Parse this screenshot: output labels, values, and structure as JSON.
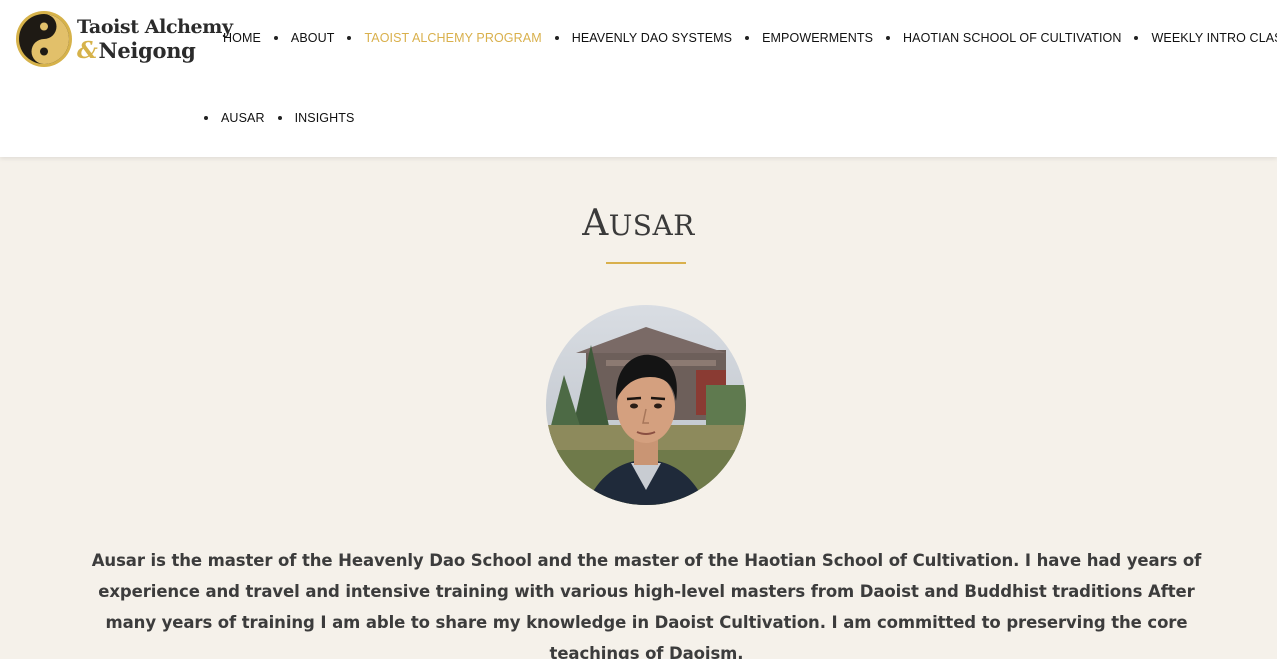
{
  "logo": {
    "line1": "Taoist Alchemy",
    "amp": "&",
    "line2": "Neigong",
    "colors": {
      "gold": "#d6b24a",
      "dark": "#2b2b2b"
    }
  },
  "nav": {
    "row1": [
      {
        "label": "HOME",
        "active": false
      },
      {
        "label": "ABOUT",
        "active": false
      },
      {
        "label": "TAOIST ALCHEMY PROGRAM",
        "active": true
      },
      {
        "label": "HEAVENLY DAO SYSTEMS",
        "active": false
      },
      {
        "label": "EMPOWERMENTS",
        "active": false
      },
      {
        "label": "HAOTIAN SCHOOL OF CULTIVATION",
        "active": false
      },
      {
        "label": "WEEKLY INTRO CLASS",
        "active": false
      }
    ],
    "row2": [
      {
        "label": "AUSAR",
        "active": false
      },
      {
        "label": "INSIGHTS",
        "active": false
      }
    ],
    "active_color": "#d9b04c"
  },
  "page": {
    "title_first": "A",
    "title_rest": "USAR",
    "bio": "Ausar is the master of the Heavenly Dao School and the master of the Haotian School of Cultivation. I have had years of experience and travel and intensive training with various high-level masters from Daoist and Buddhist traditions After many years of training I am able to share my knowledge in Daoist Cultivation. I am committed to preserving the core teachings of Daoism.",
    "accent": "#d9b04c",
    "background": "#f5f1ea"
  },
  "icons": {
    "logo": "yin-yang-icon",
    "avatar": "profile-photo"
  }
}
